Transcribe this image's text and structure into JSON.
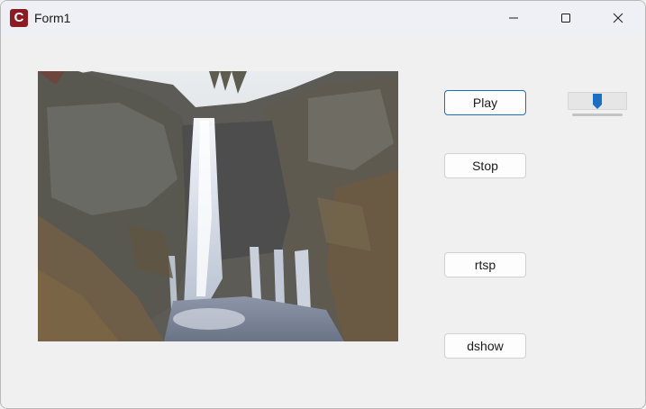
{
  "window": {
    "title": "Form1",
    "app_icon_letter": "C",
    "controls": [
      "minimize-icon",
      "maximize-icon",
      "close-icon"
    ]
  },
  "buttons": {
    "play": "Play",
    "stop": "Stop",
    "rtsp": "rtsp",
    "dshow": "dshow"
  },
  "slider": {
    "value_fraction": 0.5
  },
  "colors": {
    "accent": "#1a6fc2",
    "icon_bg": "#8a1c22"
  }
}
